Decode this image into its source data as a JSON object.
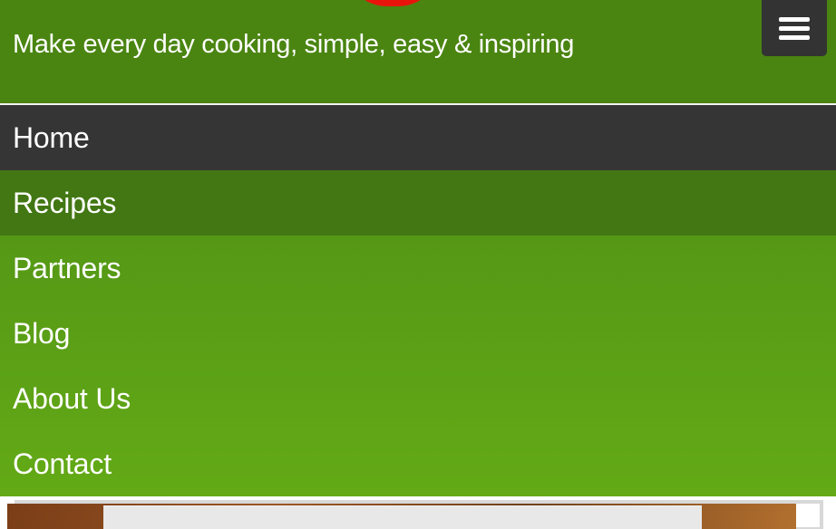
{
  "header": {
    "tagline": "Make every day cooking, simple, easy & inspiring",
    "menu_icon": "hamburger-menu-icon"
  },
  "navigation": {
    "items": [
      {
        "label": "Home",
        "state": "selected"
      },
      {
        "label": "Recipes",
        "state": "hover"
      },
      {
        "label": "Partners",
        "state": "default"
      },
      {
        "label": "Blog",
        "state": "default"
      },
      {
        "label": "About Us",
        "state": "default"
      },
      {
        "label": "Contact",
        "state": "default"
      }
    ]
  },
  "colors": {
    "brand_green": "#4a8511",
    "selected_nav": "#353535",
    "hover_nav": "#427713",
    "logo_red": "#e8140c"
  }
}
